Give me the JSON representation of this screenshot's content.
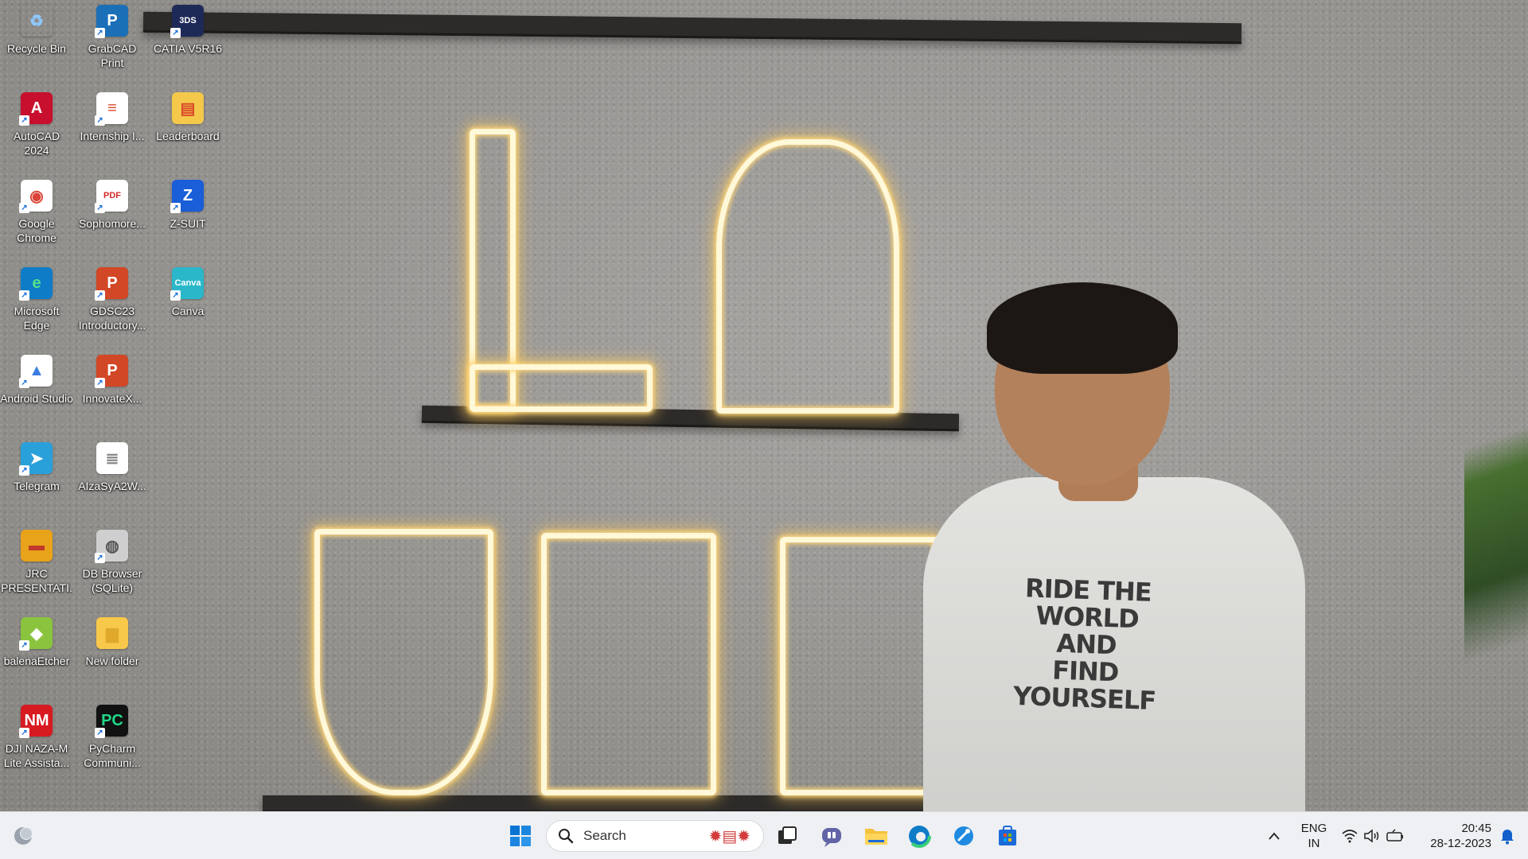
{
  "desktop": {
    "icons": [
      {
        "name": "recycle-bin",
        "label": "Recycle Bin",
        "glyph": "♻",
        "bg": "transparent",
        "fg": "#8ec8ff"
      },
      {
        "name": "grabcad-print",
        "label": "GrabCAD Print",
        "glyph": "P",
        "bg": "#1a6fb7",
        "fg": "#ffffff"
      },
      {
        "name": "catia",
        "label": "CATIA V5R16",
        "glyph": "3DS",
        "bg": "#1d2a58",
        "fg": "#ffffff"
      },
      {
        "name": "autocad",
        "label": "AutoCAD 2024",
        "glyph": "A",
        "bg": "#c8102e",
        "fg": "#ffffff"
      },
      {
        "name": "internship",
        "label": "Internship I...",
        "glyph": "≡",
        "bg": "#ffffff",
        "fg": "#d9482b"
      },
      {
        "name": "leaderboard",
        "label": "Leaderboard",
        "glyph": "▤",
        "bg": "#f4c84a",
        "fg": "#d9482b"
      },
      {
        "name": "google-chrome",
        "label": "Google Chrome",
        "glyph": "◉",
        "bg": "#ffffff",
        "fg": "#db4437"
      },
      {
        "name": "sophomore-pdf",
        "label": "Sophomore...",
        "glyph": "PDF",
        "bg": "#ffffff",
        "fg": "#d42a2a"
      },
      {
        "name": "zsuit",
        "label": "Z-SUIT",
        "glyph": "Z",
        "bg": "#1a5ed8",
        "fg": "#ffffff"
      },
      {
        "name": "microsoft-edge",
        "label": "Microsoft Edge",
        "glyph": "e",
        "bg": "#0f7cc8",
        "fg": "#53e08a"
      },
      {
        "name": "gdsc-ppt",
        "label": "GDSC23 Introductory...",
        "glyph": "P",
        "bg": "#d24726",
        "fg": "#ffffff"
      },
      {
        "name": "canva",
        "label": "Canva",
        "glyph": "Canva",
        "bg": "#29b7c9",
        "fg": "#ffffff"
      },
      {
        "name": "android-studio",
        "label": "Android Studio",
        "glyph": "▲",
        "bg": "#ffffff",
        "fg": "#3b7de0"
      },
      {
        "name": "innovatex-ppt",
        "label": "InnovateX...",
        "glyph": "P",
        "bg": "#d24726",
        "fg": "#ffffff"
      },
      {
        "name": "telegram",
        "label": "Telegram",
        "glyph": "➤",
        "bg": "#2aa0da",
        "fg": "#ffffff"
      },
      {
        "name": "aizasya2w-file",
        "label": "AIzaSyA2W...",
        "glyph": "≣",
        "bg": "#ffffff",
        "fg": "#888888"
      },
      {
        "name": "jrc-presentation",
        "label": "JRC PRESENTATI...",
        "glyph": "▬",
        "bg": "#e8a31a",
        "fg": "#c0392b"
      },
      {
        "name": "db-browser",
        "label": "DB Browser (SQLite)",
        "glyph": "◍",
        "bg": "#cfcfcf",
        "fg": "#555555"
      },
      {
        "name": "balenaetcher",
        "label": "balenaEtcher",
        "glyph": "◆",
        "bg": "#8ac43f",
        "fg": "#ffffff"
      },
      {
        "name": "new-folder",
        "label": "New folder",
        "glyph": "▆",
        "bg": "#f8c84a",
        "fg": "#e0a82a"
      },
      {
        "name": "dji-nazam",
        "label": "DJI NAZA-M Lite Assista...",
        "glyph": "NM",
        "bg": "#d71920",
        "fg": "#ffffff"
      },
      {
        "name": "pycharm",
        "label": "PyCharm Communi...",
        "glyph": "PC",
        "bg": "#111111",
        "fg": "#21d789"
      }
    ]
  },
  "wallpaper": {
    "shirt_lines": [
      "RIDE THE WORLD",
      "AND",
      "FIND YOURSELF"
    ]
  },
  "taskbar": {
    "search_placeholder": "Search",
    "language_line1": "ENG",
    "language_line2": "IN",
    "time": "20:45",
    "date": "28-12-2023"
  }
}
